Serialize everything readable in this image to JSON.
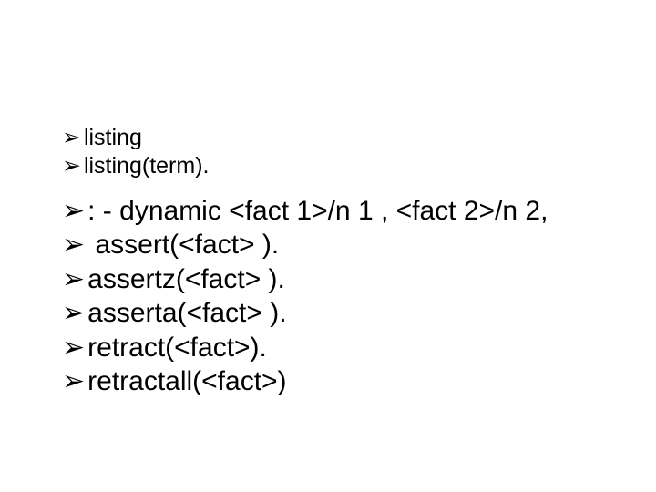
{
  "bullet_char": "➢",
  "group1": [
    "listing",
    "listing(term)."
  ],
  "group2": [
    ": - dynamic <fact 1>/n 1 , <fact 2>/n 2,",
    " assert(<fact> ).",
    "assertz(<fact> ).",
    "asserta(<fact> ).",
    "retract(<fact>).",
    "retractall(<fact>)"
  ]
}
